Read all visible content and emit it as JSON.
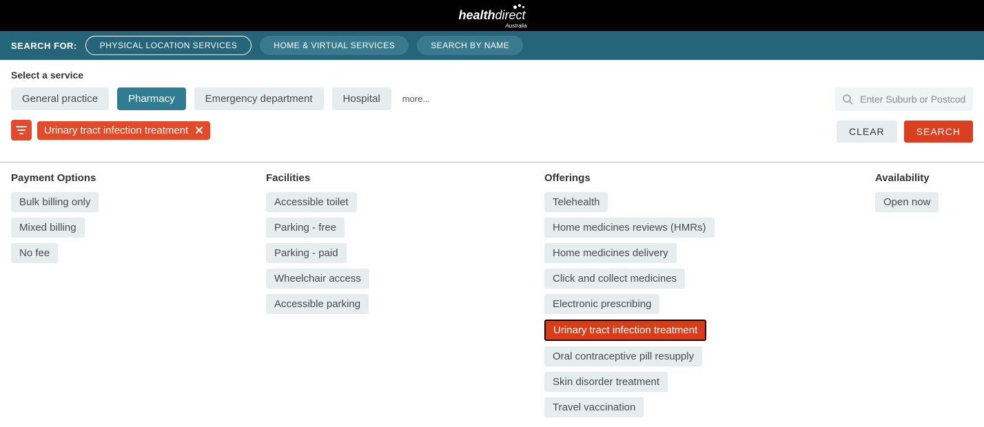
{
  "logo": {
    "main": "health",
    "sub": "direct",
    "region": "Australia"
  },
  "searchBar": {
    "label": "SEARCH FOR:",
    "tabs": [
      {
        "label": "PHYSICAL LOCATION SERVICES",
        "active": true
      },
      {
        "label": "HOME & VIRTUAL SERVICES",
        "active": false
      },
      {
        "label": "SEARCH BY NAME",
        "active": false
      }
    ]
  },
  "selectService": {
    "label": "Select a service",
    "services": [
      {
        "label": "General practice",
        "selected": false
      },
      {
        "label": "Pharmacy",
        "selected": true
      },
      {
        "label": "Emergency department",
        "selected": false
      },
      {
        "label": "Hospital",
        "selected": false
      }
    ],
    "more": "more..."
  },
  "suburbInput": {
    "placeholder": "Enter Suburb or Postcode"
  },
  "actions": {
    "clear": "CLEAR",
    "search": "SEARCH"
  },
  "appliedFilters": [
    {
      "label": "Urinary tract infection treatment"
    }
  ],
  "filterGroups": {
    "payment": {
      "heading": "Payment Options",
      "items": [
        {
          "label": "Bulk billing only",
          "selected": false
        },
        {
          "label": "Mixed billing",
          "selected": false
        },
        {
          "label": "No fee",
          "selected": false
        }
      ]
    },
    "facilities": {
      "heading": "Facilities",
      "items": [
        {
          "label": "Accessible toilet",
          "selected": false
        },
        {
          "label": "Parking - free",
          "selected": false
        },
        {
          "label": "Parking - paid",
          "selected": false
        },
        {
          "label": "Wheelchair access",
          "selected": false
        },
        {
          "label": "Accessible parking",
          "selected": false
        }
      ]
    },
    "offerings": {
      "heading": "Offerings",
      "items": [
        {
          "label": "Telehealth",
          "selected": false
        },
        {
          "label": "Home medicines reviews (HMRs)",
          "selected": false
        },
        {
          "label": "Home medicines delivery",
          "selected": false
        },
        {
          "label": "Click and collect medicines",
          "selected": false
        },
        {
          "label": "Electronic prescribing",
          "selected": false
        },
        {
          "label": "Urinary tract infection treatment",
          "selected": true
        },
        {
          "label": "Oral contraceptive pill resupply",
          "selected": false
        },
        {
          "label": "Skin disorder treatment",
          "selected": false
        },
        {
          "label": "Travel vaccination",
          "selected": false
        }
      ]
    },
    "availability": {
      "heading": "Availability",
      "items": [
        {
          "label": "Open now",
          "selected": false
        }
      ]
    }
  }
}
